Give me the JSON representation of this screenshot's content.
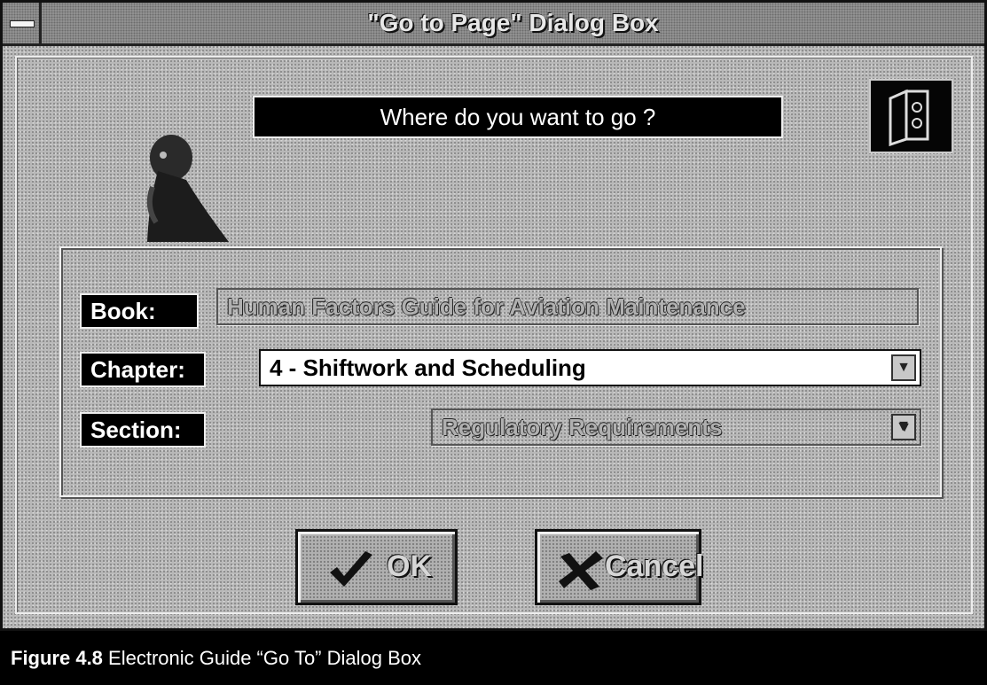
{
  "window": {
    "title": "\"Go to Page\" Dialog Box"
  },
  "prompt": "Where do you want to go ?",
  "form": {
    "book_label": "Book:",
    "book_value": "Human Factors Guide for Aviation Maintenance",
    "chapter_label": "Chapter:",
    "chapter_value": "4  -  Shiftwork and Scheduling",
    "section_label": "Section:",
    "section_value": "Regulatory Requirements"
  },
  "buttons": {
    "ok_label": "OK",
    "cancel_label": "Cancel"
  },
  "icons": {
    "system_menu": "system-menu-icon",
    "book": "book-icon",
    "thinking_person": "thinking-person-icon",
    "dropdown": "down-arrow-icon",
    "ok": "checkmark-icon",
    "cancel": "x-mark-icon"
  },
  "caption": {
    "figure_label": "Figure 4.8",
    "text": " Electronic Guide “Go To” Dialog Box"
  }
}
